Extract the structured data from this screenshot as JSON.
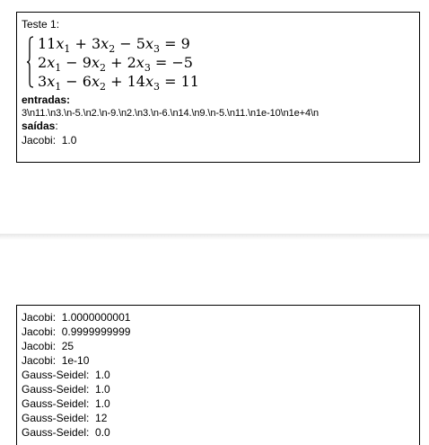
{
  "top_card": {
    "title": "Teste 1:",
    "equations": [
      [
        "11",
        "x",
        "1",
        " + 3",
        "x",
        "2",
        " − 5",
        "x",
        "3",
        " = 9"
      ],
      [
        "2",
        "x",
        "1",
        " − 9",
        "x",
        "2",
        " + 2",
        "x",
        "3",
        " = −5"
      ],
      [
        "3",
        "x",
        "1",
        " − 6",
        "x",
        "2",
        " + 14",
        "x",
        "3",
        " = 11"
      ]
    ],
    "inputs_label": "entradas:",
    "inputs_value": "3\\n11.\\n3.\\n-5.\\n2.\\n-9.\\n2.\\n3.\\n-6.\\n14.\\n9.\\n-5.\\n11.\\n1e-10\\n1e+4\\n",
    "outputs_label": "saídas",
    "outputs_colon": ":",
    "output_line": "Jacobi:  1.0"
  },
  "bottom_card": {
    "lines": [
      "Jacobi:  1.0000000001",
      "Jacobi:  0.9999999999",
      "Jacobi:  25",
      "Jacobi:  1e-10",
      "Gauss-Seidel:  1.0",
      "Gauss-Seidel:  1.0",
      "Gauss-Seidel:  1.0",
      "Gauss-Seidel:  12",
      "Gauss-Seidel:  0.0"
    ]
  }
}
